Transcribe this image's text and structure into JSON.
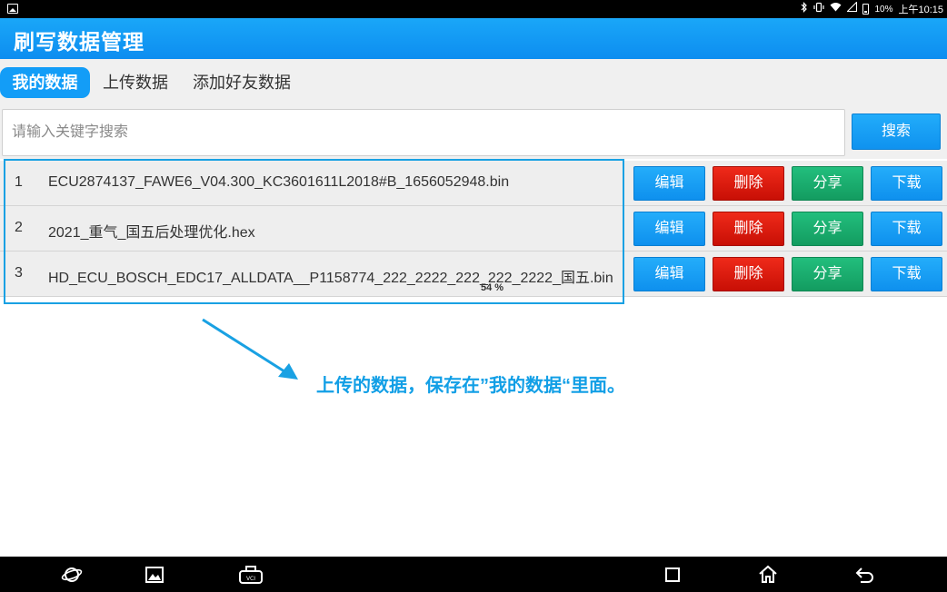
{
  "status_bar": {
    "battery": "10%",
    "time": "上午10:15"
  },
  "app": {
    "title": "刷写数据管理"
  },
  "tabs": [
    {
      "label": "我的数据",
      "active": true
    },
    {
      "label": "上传数据",
      "active": false
    },
    {
      "label": "添加好友数据",
      "active": false
    }
  ],
  "search": {
    "placeholder": "请输入关键字搜索",
    "value": "",
    "button_label": "搜索"
  },
  "row_actions": {
    "edit": "编辑",
    "delete": "删除",
    "share": "分享",
    "download": "下载"
  },
  "files": [
    {
      "index": "1",
      "name": "ECU2874137_FAWE6_V04.300_KC3601611L2018#B_1656052948.bin"
    },
    {
      "index": "2",
      "name": "2021_重气_国五后处理优化.hex"
    },
    {
      "index": "3",
      "name": "HD_ECU_BOSCH_EDC17_ALLDATA__P1158774_222_2222_222_222_2222_国五.bin",
      "progress": "54 %"
    }
  ],
  "annotation": {
    "text": "上传的数据，保存在”我的数据“里面。"
  },
  "colors": {
    "primary": "#139df7",
    "delete": "#d81b0e",
    "share": "#19ad6e",
    "annotation": "#129fe6"
  }
}
